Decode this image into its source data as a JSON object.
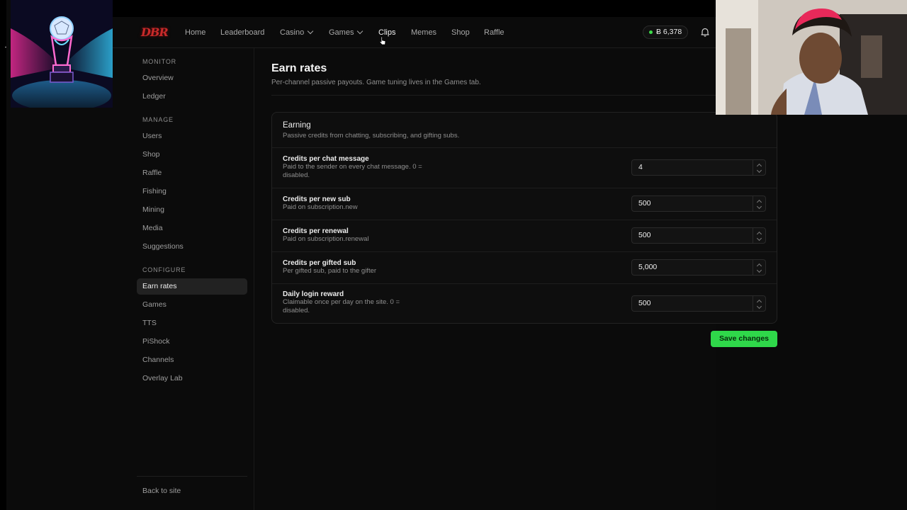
{
  "brand": {
    "logo_text": "DBR",
    "logo_color": "#c92a2a"
  },
  "nav": {
    "items": [
      {
        "label": "Home"
      },
      {
        "label": "Leaderboard"
      },
      {
        "label": "Casino",
        "dropdown": true
      },
      {
        "label": "Games",
        "dropdown": true
      },
      {
        "label": "Clips",
        "active": true
      },
      {
        "label": "Memes"
      },
      {
        "label": "Shop"
      },
      {
        "label": "Raffle"
      }
    ],
    "balance": "Ƀ 6,378",
    "balance_status_color": "#3ddc4a",
    "bell_icon": "bell-icon"
  },
  "sidebar": {
    "sections": [
      {
        "label": "MONITOR",
        "items": [
          "Overview",
          "Ledger"
        ]
      },
      {
        "label": "MANAGE",
        "items": [
          "Users",
          "Shop",
          "Raffle",
          "Fishing",
          "Mining",
          "Media",
          "Suggestions"
        ]
      },
      {
        "label": "CONFIGURE",
        "items": [
          "Earn rates",
          "Games",
          "TTS",
          "PiShock",
          "Channels",
          "Overlay Lab"
        ]
      }
    ],
    "active_item": "Earn rates",
    "back_link": "Back to site"
  },
  "main": {
    "title": "Earn rates",
    "subtitle": "Per-channel passive payouts. Game tuning lives in the Games tab.",
    "card": {
      "title": "Earning",
      "subtitle": "Passive credits from chatting, subscribing, and gifting subs.",
      "rows": [
        {
          "title": "Credits per chat message",
          "desc_line1": "Paid to the sender on every chat message. 0 =",
          "desc_line2": "disabled.",
          "value": "4"
        },
        {
          "title": "Credits per new sub",
          "desc_line1": "Paid on subscription.new",
          "desc_line2": "",
          "value": "500"
        },
        {
          "title": "Credits per renewal",
          "desc_line1": "Paid on subscription.renewal",
          "desc_line2": "",
          "value": "500"
        },
        {
          "title": "Credits per gifted sub",
          "desc_line1": "Per gifted sub, paid to the gifter",
          "desc_line2": "",
          "value": "5,000"
        },
        {
          "title": "Daily login reward",
          "desc_line1": "Claimable once per day on the site. 0 =",
          "desc_line2": "disabled.",
          "value": "500"
        }
      ]
    },
    "save_label": "Save changes",
    "accent_color": "#2fd84a"
  }
}
